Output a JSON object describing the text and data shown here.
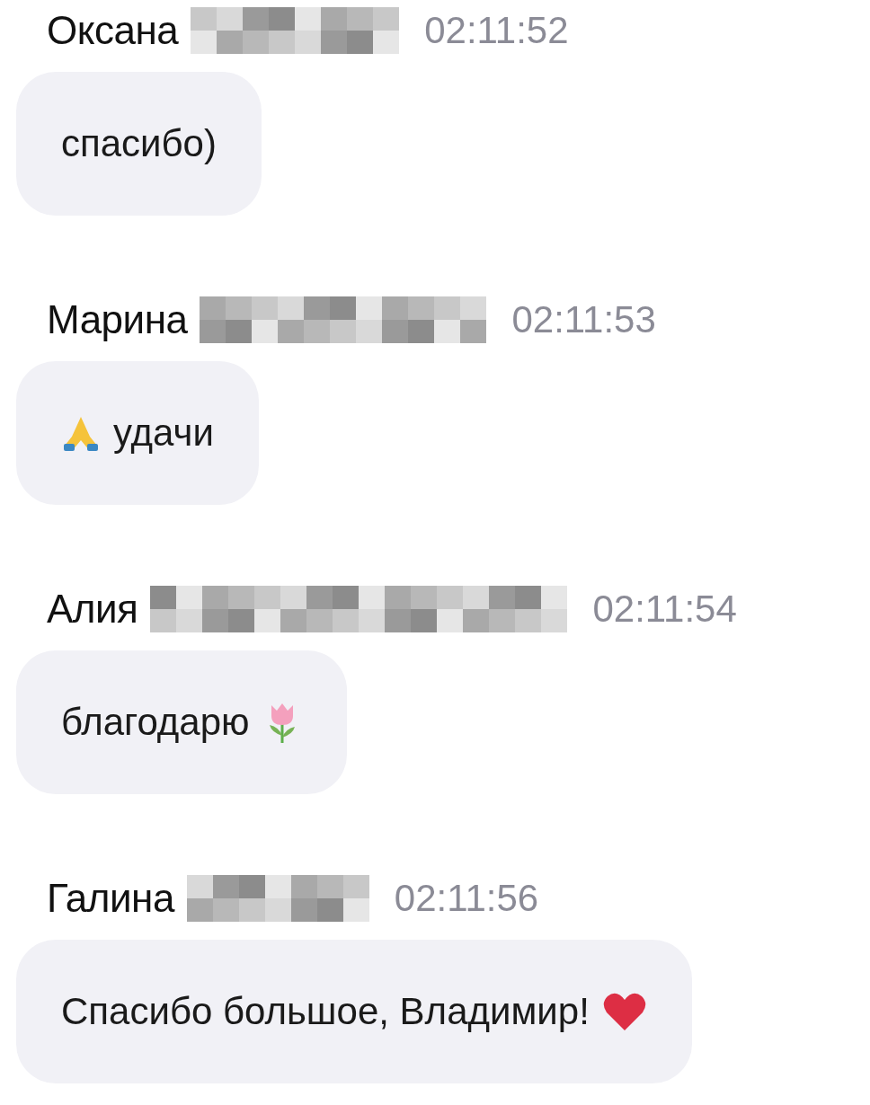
{
  "messages": [
    {
      "author": "Оксана",
      "time": "02:11:52",
      "text": "спасибо)",
      "kind": "plain"
    },
    {
      "author": "Марина",
      "time": "02:11:53",
      "text": "удачи",
      "kind": "leading"
    },
    {
      "author": "Алия",
      "time": "02:11:54",
      "text": "благодарю",
      "kind": "trailing"
    },
    {
      "author": "Галина",
      "time": "02:11:56",
      "text": "Спасибо большое, Владимир!",
      "kind": "trailing"
    }
  ]
}
